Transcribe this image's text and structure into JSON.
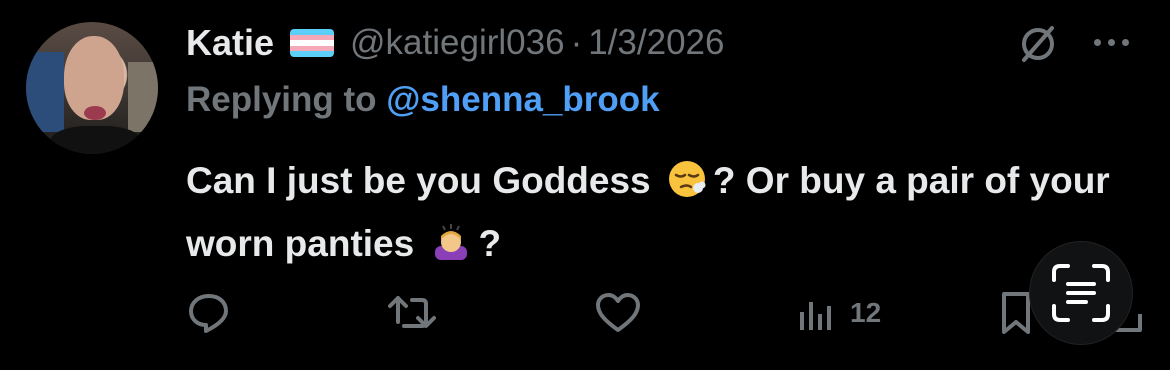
{
  "tweet": {
    "author_name": "Katie",
    "flag_colors": [
      "#5bcefa",
      "#f5a9b8",
      "#ffffff",
      "#f5a9b8",
      "#5bcefa"
    ],
    "handle": "@katiegirl036",
    "separator": "·",
    "date": "1/3/2026",
    "reply_label": "Replying to",
    "reply_user": "@shenna_brook",
    "body_part1": "Can I just be you Goddess",
    "body_part2": "? Or buy a pair of your worn panties",
    "body_part3": "?",
    "emoji_1": "exhausted-face-emoji",
    "emoji_2": "person-bowing-emoji"
  },
  "actions": {
    "views_count": "12"
  },
  "colors": {
    "background": "#000000",
    "primary_text": "#e7e9ea",
    "secondary_text": "#71767b",
    "link": "#4f9ff6"
  }
}
